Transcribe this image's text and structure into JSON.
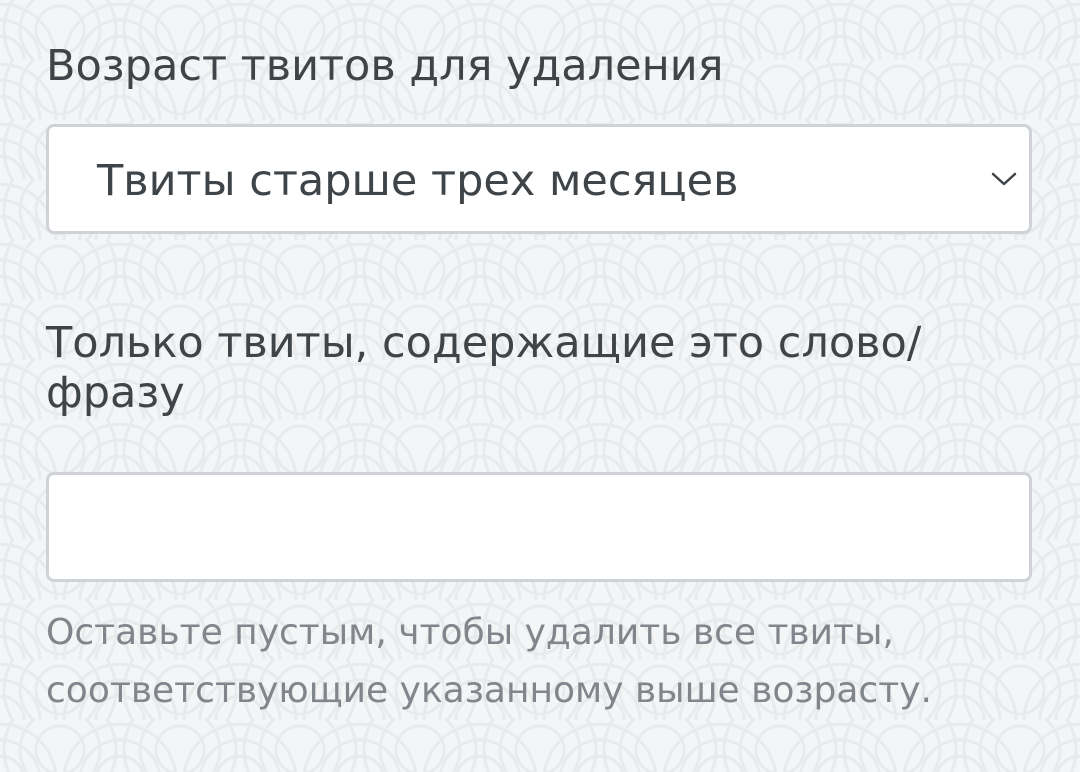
{
  "form": {
    "age_label": "Возраст твитов для удаления",
    "age_select": {
      "selected": "Твиты старше трех месяцев",
      "icon": "chevron-down-icon"
    },
    "phrase_label": {
      "line1": "Только твиты, содержащие это слово/",
      "line2": "фразу"
    },
    "phrase_input": {
      "value": ""
    },
    "help_text": {
      "line1": "Оставьте пустым, чтобы удалить все твиты,",
      "line2": "соответствующие указанному выше возрасту."
    }
  },
  "colors": {
    "background": "#f4f5f6",
    "pattern": "#e9ebed",
    "label_text": "#3f4448",
    "help_text": "#80868c",
    "field_border": "#cfd2d6",
    "field_background": "#ffffff"
  }
}
